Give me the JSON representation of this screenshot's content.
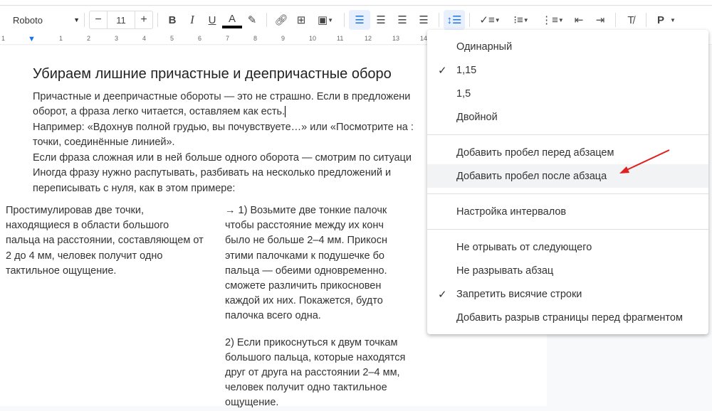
{
  "toolbar": {
    "font": "Roboto",
    "font_size": "11",
    "minus": "−",
    "plus": "+",
    "bold": "B",
    "italic": "I",
    "underline": "U",
    "text_color": "A",
    "styles": "P"
  },
  "ruler": {
    "ticks": [
      "1",
      "1",
      "2",
      "3",
      "4",
      "5",
      "6",
      "7",
      "8",
      "9",
      "10",
      "11",
      "12",
      "13",
      "14"
    ]
  },
  "document": {
    "heading": "Убираем лишние причастные и деепричастные оборо",
    "lines": [
      "Причастные и деепричастные обороты — это не страшно. Если в предложени",
      "оборот, а фраза легко читается, оставляем как есть.",
      "Например: «Вдохнув полной грудью, вы почувствуете…» или «Посмотрите на :",
      "точки, соединённые линией».",
      "Если фраза сложная или в ней больше одного оборота — смотрим по ситуаци",
      "Иногда фразу нужно распутывать, разбивать на несколько предложений и",
      "переписывать с нуля, как в этом примере:"
    ],
    "col1": [
      "Простимулировав две точки,",
      "находящиеся в области большого",
      "пальца на расстоянии, составляющем от",
      "2 до 4 мм, человек получит одно",
      "тактильное ощущение."
    ],
    "col2a": [
      "→ 1) Возьмите две тонкие палочк",
      "чтобы расстояние между их конч",
      "было не больше 2–4 мм. Прикосн",
      "этими палочками к подушечке бо",
      "пальца — обеими одновременно.",
      "сможете различить прикосновен",
      "каждой их них. Покажется, будто",
      "палочка всего одна."
    ],
    "col2b": [
      "2) Если прикоснуться к двум точкам",
      "большого пальца, которые находятся",
      "друг от друга на расстоянии 2–4 мм,",
      "человек получит одно тактильное",
      "ощущение."
    ]
  },
  "menu": {
    "spacing": [
      {
        "label": "Одинарный",
        "checked": false
      },
      {
        "label": "1,15",
        "checked": true
      },
      {
        "label": "1,5",
        "checked": false
      },
      {
        "label": "Двойной",
        "checked": false
      }
    ],
    "paragraph": [
      "Добавить пробел перед абзацем",
      "Добавить пробел после абзаца"
    ],
    "custom": "Настройка интервалов",
    "pagination": [
      {
        "label": "Не отрывать от следующего",
        "checked": false
      },
      {
        "label": "Не разрывать абзац",
        "checked": false
      },
      {
        "label": "Запретить висячие строки",
        "checked": true
      },
      {
        "label": "Добавить разрыв страницы перед фрагментом",
        "checked": false
      }
    ]
  },
  "colors": {
    "accent": "#1a73e8",
    "arrow": "#e02020"
  }
}
